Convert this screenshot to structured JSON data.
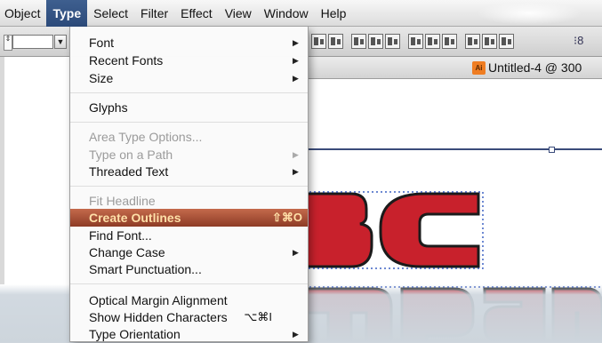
{
  "menubar": {
    "items": [
      "Object",
      "Type",
      "Select",
      "Filter",
      "Effect",
      "View",
      "Window",
      "Help"
    ]
  },
  "toolbar": {
    "more_glyph": "⁝8"
  },
  "document": {
    "tab_title": "Untitled-4 @ 300",
    "file_badge": "Ai"
  },
  "type_menu": {
    "items": [
      {
        "label": "Font",
        "submenu": true
      },
      {
        "label": "Recent Fonts",
        "submenu": true
      },
      {
        "label": "Size",
        "submenu": true
      },
      {
        "label": "Glyphs"
      },
      {
        "label": "Area Type Options...",
        "disabled": true
      },
      {
        "label": "Type on a Path",
        "disabled": true,
        "submenu": true
      },
      {
        "label": "Threaded Text",
        "submenu": true
      },
      {
        "label": "Fit Headline",
        "disabled": true
      },
      {
        "label": "Create Outlines",
        "shortcut": "⇧⌘O",
        "highlighted": true
      },
      {
        "label": "Find Font..."
      },
      {
        "label": "Change Case",
        "submenu": true
      },
      {
        "label": "Smart Punctuation..."
      },
      {
        "label": "Optical Margin Alignment"
      },
      {
        "label": "Show Hidden Characters",
        "shortcut": "⌥⌘I"
      },
      {
        "label": "Type Orientation",
        "submenu": true
      }
    ]
  },
  "artwork": {
    "fill_color": "#c8212c",
    "outline_color": "#1b1b1b",
    "selection_color": "#3a4b7a"
  }
}
